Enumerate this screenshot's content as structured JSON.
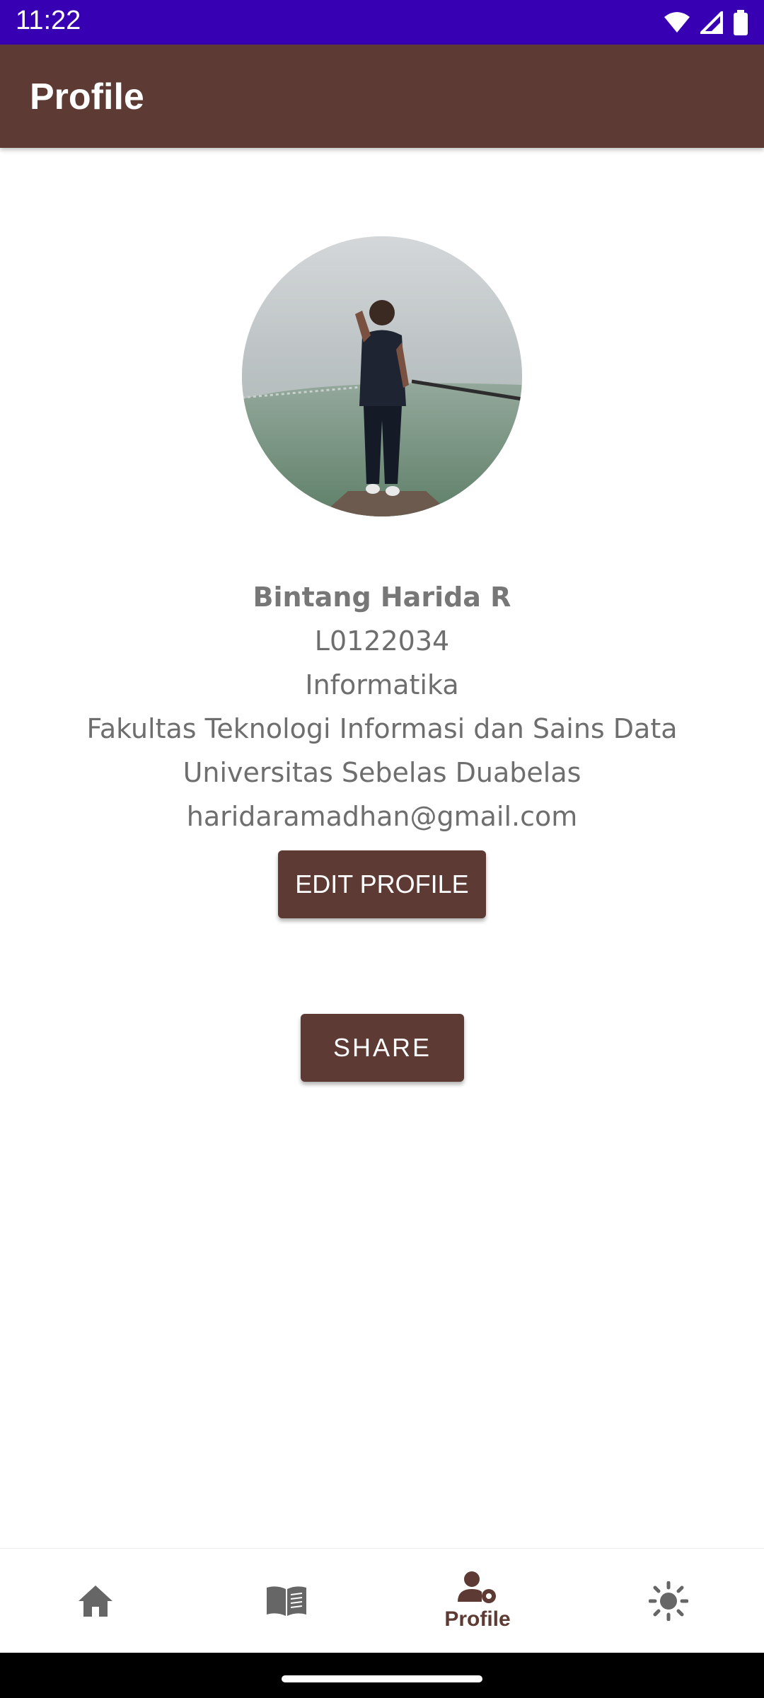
{
  "status_bar": {
    "time": "11:22",
    "background": "#3700b3"
  },
  "app_bar": {
    "title": "Profile",
    "background": "#5d3a33"
  },
  "profile": {
    "avatar_alt": "profile photo",
    "name": "Bintang Harida R",
    "nim": "L0122034",
    "major": "Informatika",
    "faculty": "Fakultas Teknologi Informasi dan Sains Data",
    "university": "Universitas Sebelas Duabelas",
    "email": "haridaramadhan@gmail.com"
  },
  "buttons": {
    "edit_profile": "EDIT PROFILE",
    "share": "SHARE"
  },
  "bottom_nav": {
    "items": [
      {
        "icon": "home-icon",
        "label": ""
      },
      {
        "icon": "book-icon",
        "label": ""
      },
      {
        "icon": "profile-settings-icon",
        "label": "Profile",
        "active": true
      },
      {
        "icon": "brightness-icon",
        "label": ""
      }
    ]
  },
  "colors": {
    "accent": "#5d3a33",
    "text_secondary": "#6e6e6e"
  }
}
